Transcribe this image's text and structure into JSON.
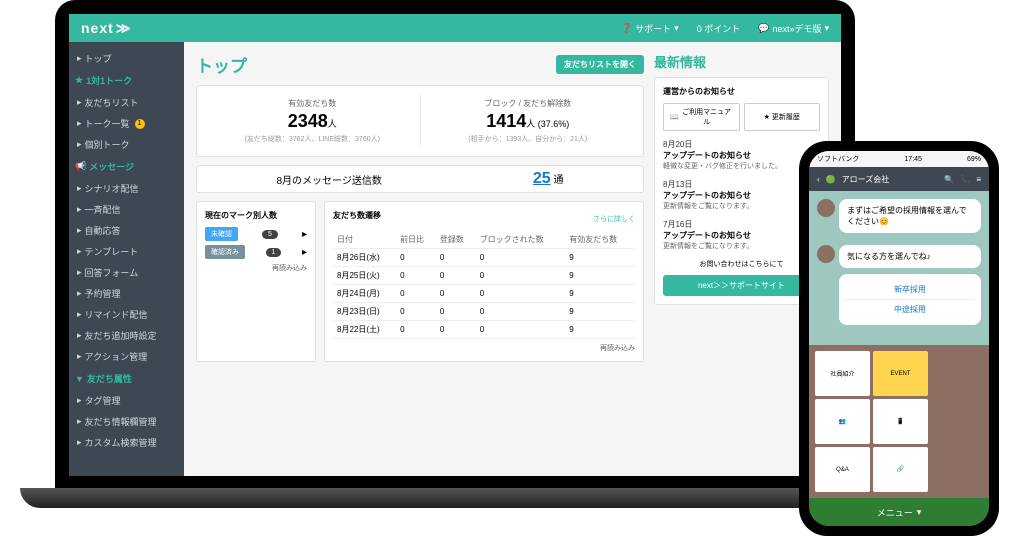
{
  "topbar": {
    "logo": "next",
    "support": "サポート",
    "points": "0 ポイント",
    "account": "next»デモ版"
  },
  "sidebar": {
    "top": "トップ",
    "talk_head": "1対1トーク",
    "friend_list": "友だちリスト",
    "talk_list": "トーク一覧",
    "indiv_talk": "個別トーク",
    "msg_head": "メッセージ",
    "scenario": "シナリオ配信",
    "broadcast": "一斉配信",
    "auto": "自動応答",
    "template": "テンプレート",
    "form": "回答フォーム",
    "reserve": "予約管理",
    "remind": "リマインド配信",
    "friend_add": "友だち追加時設定",
    "action": "アクション管理",
    "attr_head": "友だち属性",
    "tag": "タグ管理",
    "info": "友だち情報欄管理",
    "custom": "カスタム検索管理"
  },
  "page": {
    "title": "トップ",
    "open_list": "友だちリストを開く"
  },
  "stats": {
    "valid_label": "有効友だち数",
    "valid_val": "2348",
    "valid_unit": "人",
    "valid_sub": "(友だち総数：3762人、LINE総数：3760人)",
    "block_label": "ブロック / 友だち解除数",
    "block_val": "1414",
    "block_unit": "人 (37.6%)",
    "block_sub": "(相手から：1393人、自分から：21人)"
  },
  "msg": {
    "label": "8月のメッセージ送信数",
    "val": "25",
    "unit": "通"
  },
  "mark": {
    "title": "現在のマーク別人数",
    "tag1": "未確認",
    "cnt1": "5",
    "tag2": "確認済み",
    "cnt2": "1",
    "reload": "再読み込み"
  },
  "trans": {
    "title": "友だち数遷移",
    "more": "さらに詳しく",
    "cols": [
      "日付",
      "前日比",
      "登録数",
      "ブロックされた数",
      "有効友だち数"
    ],
    "rows": [
      {
        "d": "8月26日(水)",
        "a": "0",
        "b": "0",
        "c": "0",
        "e": "9"
      },
      {
        "d": "8月25日(火)",
        "a": "0",
        "b": "0",
        "c": "0",
        "e": "9"
      },
      {
        "d": "8月24日(月)",
        "a": "0",
        "b": "0",
        "c": "0",
        "e": "9"
      },
      {
        "d": "8月23日(日)",
        "a": "0",
        "b": "0",
        "c": "0",
        "e": "9"
      },
      {
        "d": "8月22日(土)",
        "a": "0",
        "b": "0",
        "c": "0",
        "e": "9"
      }
    ],
    "reload": "再読み込み"
  },
  "news": {
    "title": "最新情報",
    "sub": "運営からのお知らせ",
    "btn1": "ご利用マニュアル",
    "btn2": "更新履歴",
    "items": [
      {
        "date": "8月20日",
        "title": "アップデートのお知らせ",
        "desc": "軽微な変更・バグ修正を行いました。"
      },
      {
        "date": "8月13日",
        "title": "アップデートのお知らせ",
        "desc": "更新情報をご覧になります。"
      },
      {
        "date": "7月16日",
        "title": "アップデートのお知らせ",
        "desc": "更新情報をご覧になります。"
      }
    ],
    "contact": "お問い合わせはこちらにて",
    "support": "next＞＞サポートサイト"
  },
  "phone": {
    "carrier": "ソフトバンク",
    "time": "17:45",
    "batt": "69%",
    "header": "アローズ会社",
    "bubble1": "まずはご希望の採用情報を選んでください😊",
    "bubble2": "気になる方を選んでね♪",
    "opt1": "新卒採用",
    "opt2": "中途採用",
    "card1": "社員紹介",
    "card2": "EVENT",
    "card3": "Q&A",
    "menu": "メニュー"
  }
}
